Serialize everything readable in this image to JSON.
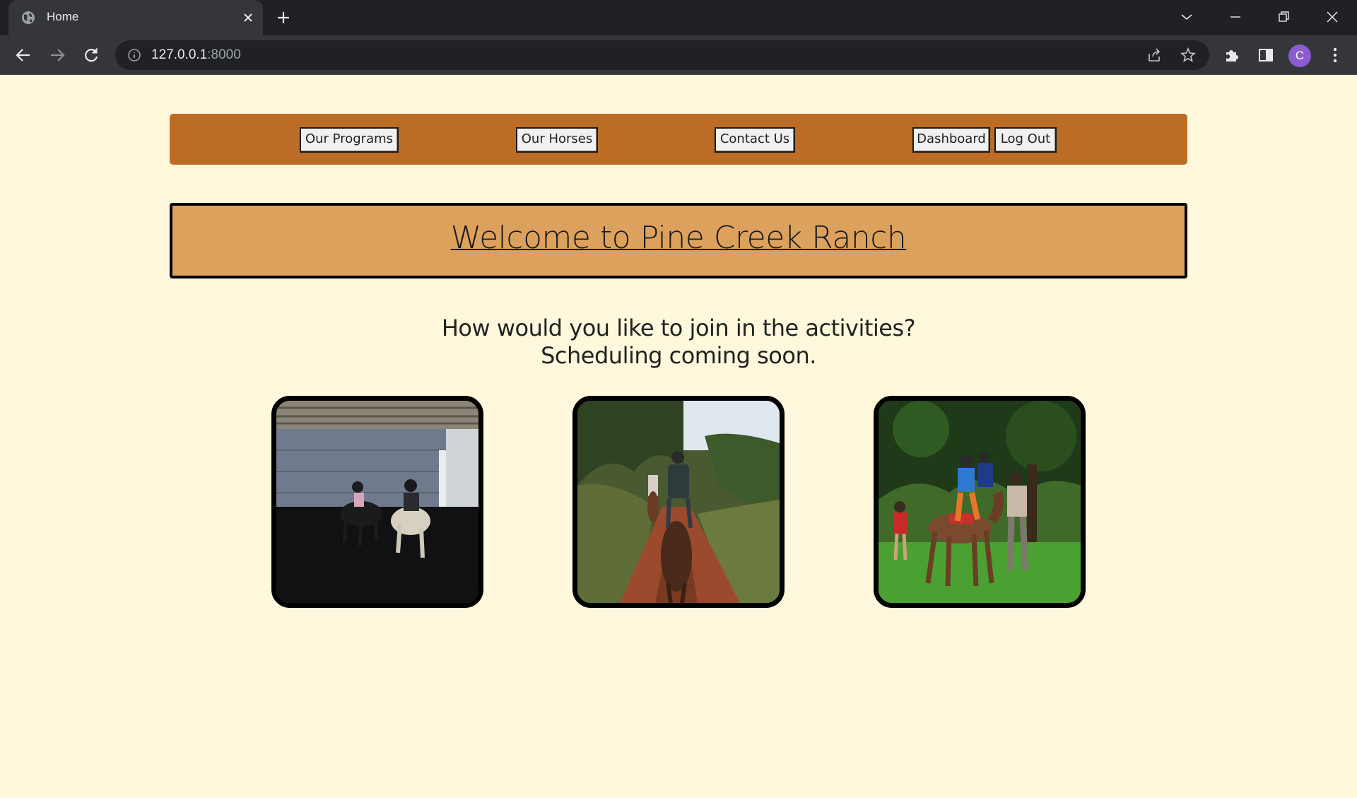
{
  "browser": {
    "tab_title": "Home",
    "url_host": "127.0.0.1",
    "url_port": ":8000",
    "profile_initial": "C"
  },
  "nav": {
    "our_programs": "Our Programs",
    "our_horses": "Our Horses",
    "contact_us": "Contact Us",
    "dashboard": "Dashboard",
    "log_out": "Log Out"
  },
  "hero": {
    "title": "Welcome to Pine Creek Ranch"
  },
  "intro": {
    "line1": "How would you like to join in the activities?",
    "line2": "Scheduling coming soon."
  },
  "colors": {
    "page_bg": "#fff8dc",
    "navbar_bg": "#bc6c25",
    "hero_bg": "#dda15e"
  },
  "icons": [
    "globe-icon",
    "close-icon",
    "plus-icon",
    "chevron-down-icon",
    "minimize-icon",
    "restore-icon",
    "window-close-icon",
    "back-arrow-icon",
    "forward-arrow-icon",
    "reload-icon",
    "info-icon",
    "share-icon",
    "star-icon",
    "puzzle-icon",
    "side-panel-icon",
    "kebab-menu-icon"
  ]
}
